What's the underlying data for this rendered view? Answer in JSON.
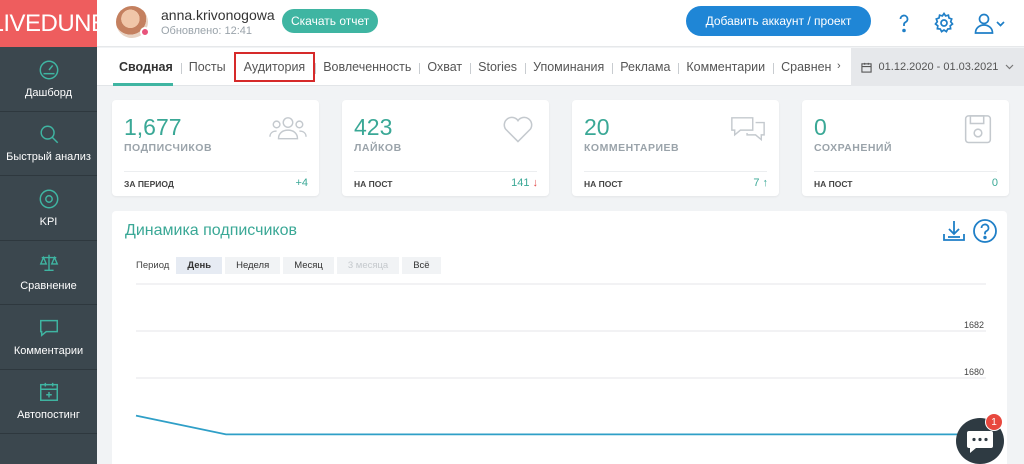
{
  "brand": {
    "logo_text": "LIVEDUNE",
    "logo_color": "#ee5d5e",
    "accent": "#3fb5a2",
    "primary_blue": "#1f86d6"
  },
  "sidebar": {
    "items": [
      {
        "label": "Дашборд",
        "icon": "speedometer-icon"
      },
      {
        "label": "Быстрый анализ",
        "icon": "search-icon"
      },
      {
        "label": "KPI",
        "icon": "target-icon"
      },
      {
        "label": "Сравнение",
        "icon": "scales-icon"
      },
      {
        "label": "Комментарии",
        "icon": "comment-icon"
      },
      {
        "label": "Автопостинг",
        "icon": "calendar-plus-icon"
      }
    ]
  },
  "header": {
    "username": "anna.krivonogowa",
    "updated": "Обновлено: 12:41",
    "report_button": "Скачать отчет",
    "add_button": "Добавить аккаунт / проект"
  },
  "tabs": {
    "items": [
      "Сводная",
      "Посты",
      "Аудитория",
      "Вовлеченность",
      "Охват",
      "Stories",
      "Упоминания",
      "Реклама",
      "Комментарии",
      "Сравнен"
    ],
    "active": "Сводная",
    "highlighted": "Аудитория",
    "more_arrow": "›",
    "date_range": "01.12.2020 - 01.03.2021"
  },
  "cards": [
    {
      "value": "1,677",
      "label": "ПОДПИСЧИКОВ",
      "sub": "ЗА ПЕРИОД",
      "delta": "+4",
      "arrow": "",
      "icon": "people-icon"
    },
    {
      "value": "423",
      "label": "ЛАЙКОВ",
      "sub": "НА ПОСТ",
      "delta": "141",
      "arrow": "↓",
      "icon": "heart-icon"
    },
    {
      "value": "20",
      "label": "КОММЕНТАРИЕВ",
      "sub": "НА ПОСТ",
      "delta": "7",
      "arrow": "↑",
      "icon": "comments-icon"
    },
    {
      "value": "0",
      "label": "СОХРАНЕНИЙ",
      "sub": "НА ПОСТ",
      "delta": "0",
      "arrow": "",
      "icon": "save-icon"
    }
  ],
  "panel": {
    "title": "Динамика подписчиков",
    "period_label": "Период",
    "period_options": [
      "День",
      "Неделя",
      "Месяц",
      "3 месяца",
      "Всё"
    ],
    "period_active": "День",
    "period_disabled": "3 месяца"
  },
  "chart_data": {
    "type": "line",
    "yticks": [
      1682,
      1680
    ],
    "series": [
      {
        "values": [
          1678.4,
          1677.6,
          1677.6,
          1677.6,
          1677.6,
          1677.6,
          1677.6,
          1677.6,
          1677.6,
          1677.6
        ]
      }
    ],
    "grid": true,
    "line_color": "#2f9fc7"
  },
  "chat": {
    "badge": "1"
  }
}
